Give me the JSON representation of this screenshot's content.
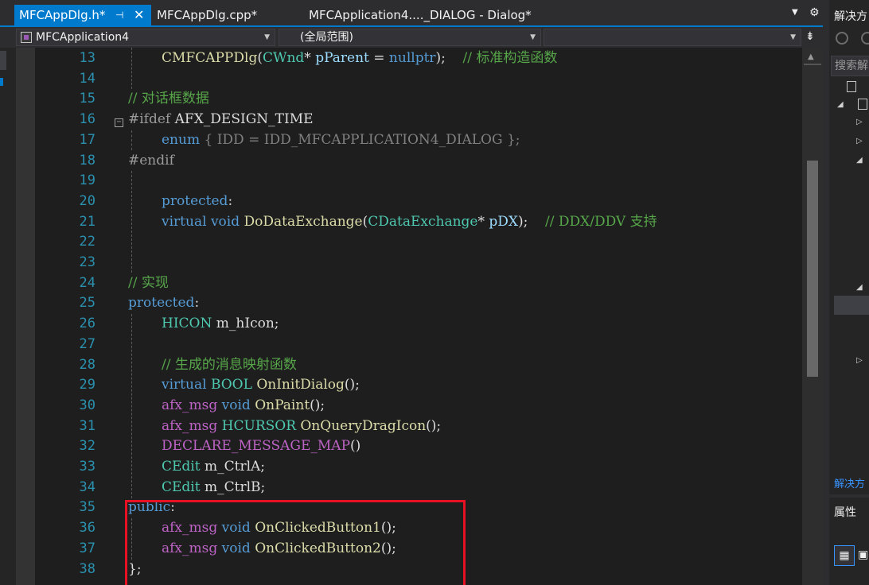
{
  "tabs": [
    {
      "label": "MFCAppDlg.h*",
      "pin_icon": "pin-icon",
      "close_icon": "close-icon",
      "active": true
    },
    {
      "label": "MFCAppDlg.cpp*",
      "active": false
    },
    {
      "label": "MFCApplication4...._DIALOG - Dialog*",
      "active": false
    }
  ],
  "navbar": {
    "project": "MFCApplication4",
    "scope": "(全局范围)",
    "member": ""
  },
  "colors": {
    "accent": "#007acc",
    "editor_bg": "#1e1e1e",
    "keyword": "#569cd6",
    "type": "#4ec9b0",
    "function": "#dcdcaa",
    "comment": "#57a64a",
    "macro": "#bd63c5",
    "line_number": "#2b91af",
    "highlight_box": "#e81123"
  },
  "code": {
    "line_numbers": [
      "13",
      "14",
      "15",
      "16",
      "17",
      "18",
      "19",
      "20",
      "21",
      "22",
      "23",
      "24",
      "25",
      "26",
      "27",
      "28",
      "29",
      "30",
      "31",
      "32",
      "33",
      "34",
      "35",
      "36",
      "37",
      "38"
    ],
    "l13": {
      "fn": "CMFCAPPDlg",
      "p1": "(",
      "ty": "CWnd",
      "p2": "* ",
      "ph": "pParent",
      "p3": " = ",
      "kw": "nullptr",
      "p4": ");    ",
      "cm": "// 标准构造函数"
    },
    "l15": {
      "cm": "// 对话框数据"
    },
    "l16": {
      "pp": "#ifdef ",
      "txt": "AFX_DESIGN_TIME"
    },
    "l17": {
      "kw": "enum",
      "d1": " { ",
      "txt": "IDD = IDD_MFCAPPLICATION4_DIALOG",
      "d2": " };"
    },
    "l18": {
      "pp": "#endif"
    },
    "l20": {
      "kw": "protected",
      "p": ":"
    },
    "l21": {
      "kw1": "virtual",
      "sp1": " ",
      "kw2": "void",
      "sp2": " ",
      "fn": "DoDataExchange",
      "p1": "(",
      "ty": "CDataExchange",
      "p2": "* ",
      "ph": "pDX",
      "p3": ");    ",
      "cm": "// DDX/DDV 支持"
    },
    "l24": {
      "cm": "// 实现"
    },
    "l25": {
      "kw": "protected",
      "p": ":"
    },
    "l26": {
      "ty": "HICON",
      "txt": " m_hIcon;"
    },
    "l28": {
      "cm": "// 生成的消息映射函数"
    },
    "l29": {
      "kw": "virtual",
      "sp": " ",
      "ty": "BOOL",
      "sp2": " ",
      "fn": "OnInitDialog",
      "p": "();"
    },
    "l30": {
      "mc": "afx_msg",
      "sp": " ",
      "kw": "void",
      "sp2": " ",
      "fn": "OnPaint",
      "p": "();"
    },
    "l31": {
      "mc": "afx_msg",
      "sp": " ",
      "ty": "HCURSOR",
      "sp2": " ",
      "fn": "OnQueryDragIcon",
      "p": "();"
    },
    "l32": {
      "mc": "DECLARE_MESSAGE_MAP",
      "p": "()"
    },
    "l33": {
      "ty": "CEdit",
      "txt": " m_CtrlA;"
    },
    "l34": {
      "ty": "CEdit",
      "txt": " m_CtrlB;"
    },
    "l35": {
      "kw": "public",
      "p": ":"
    },
    "l36": {
      "mc": "afx_msg",
      "sp": " ",
      "kw": "void",
      "sp2": " ",
      "fn": "OnClickedButton1",
      "p": "();"
    },
    "l37": {
      "mc": "afx_msg",
      "sp": " ",
      "kw": "void",
      "sp2": " ",
      "fn": "OnClickedButton2",
      "p": "();"
    },
    "l38": {
      "p": "};"
    }
  },
  "right_panel": {
    "title": "解决方",
    "search": "搜索解",
    "footer_link": "解决方",
    "properties": "属性"
  }
}
